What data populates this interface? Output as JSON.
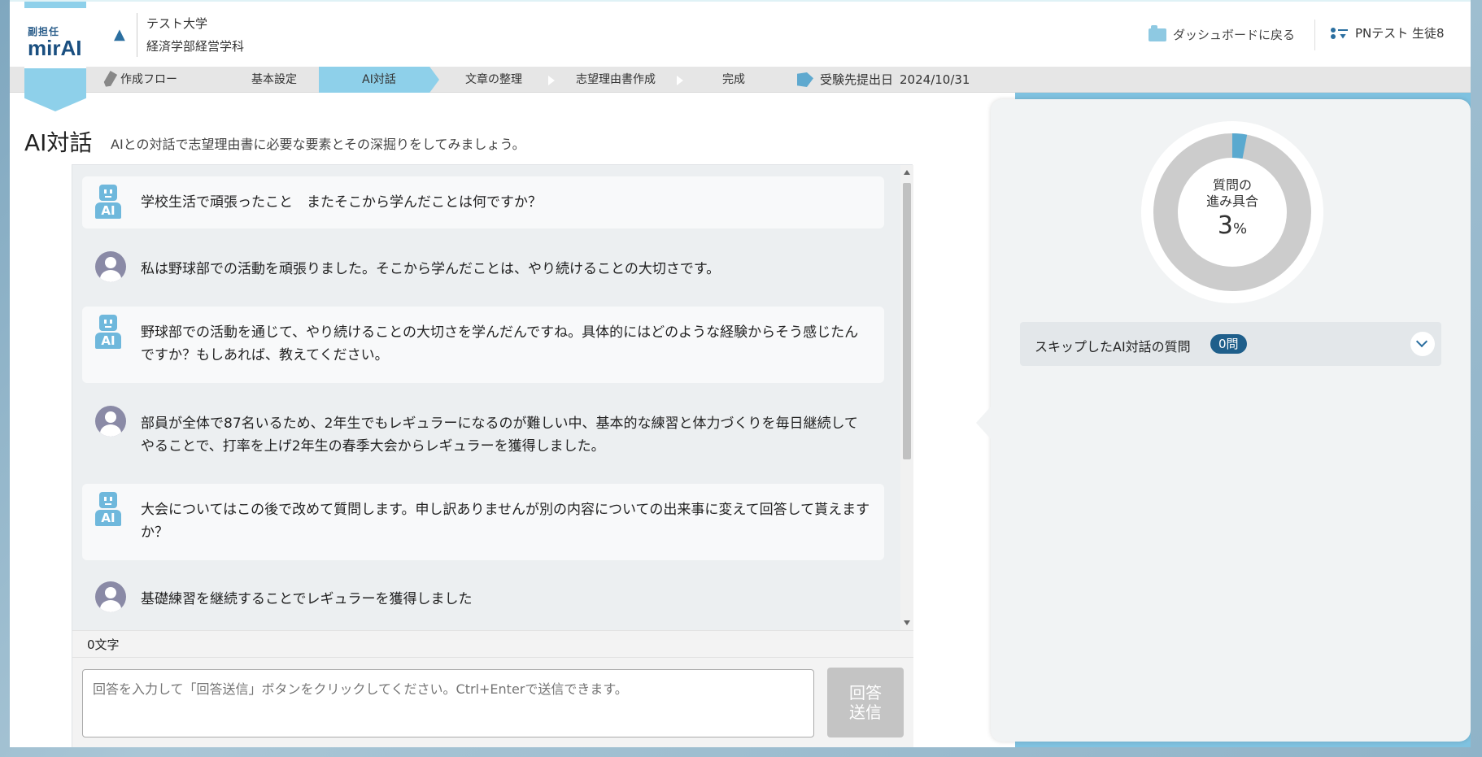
{
  "header": {
    "logo_small": "副担任",
    "logo_main": "mirAI",
    "university": "テスト大学",
    "department": "経済学部経営学科",
    "dashboard_link": "ダッシュボードに戻る",
    "user_name": "PNテスト 生徒8"
  },
  "steps": {
    "flow_label": "作成フロー",
    "items": [
      "基本設定",
      "AI対話",
      "文章の整理",
      "志望理由書作成",
      "完成"
    ],
    "active_index": 1,
    "deadline_label": "受験先提出日",
    "deadline_date": "2024/10/31"
  },
  "page": {
    "title": "AI対話",
    "description": "AIとの対話で志望理由書に必要な要素とその深掘りをしてみましょう。"
  },
  "icons": {
    "ai_badge": "AI"
  },
  "messages": [
    {
      "role": "ai",
      "text": "学校生活で頑張ったこと　またそこから学んだことは何ですか？"
    },
    {
      "role": "user",
      "text": "私は野球部での活動を頑張りました。そこから学んだことは、やり続けることの大切さです。"
    },
    {
      "role": "ai",
      "text": "野球部での活動を通じて、やり続けることの大切さを学んだんですね。具体的にはどのような経験からそう感じたんですか？もしあれば、教えてください。"
    },
    {
      "role": "user",
      "text": "部員が全体で87名いるため、2年生でもレギュラーになるのが難しい中、基本的な練習と体力づくりを毎日継続してやることで、打率を上げ2年生の春季大会からレギュラーを獲得しました。"
    },
    {
      "role": "ai",
      "text": "大会についてはこの後で改めて質問します。申し訳ありませんが別の内容についての出来事に変えて回答して貰えますか？"
    },
    {
      "role": "user",
      "text": "基礎練習を継続することでレギュラーを獲得しました"
    }
  ],
  "input": {
    "char_count": "0文字",
    "placeholder": "回答を入力して「回答送信」ボタンをクリックしてください。Ctrl+Enterで送信できます。",
    "value": "",
    "send_label_line1": "回答",
    "send_label_line2": "送信"
  },
  "progress": {
    "label_line1": "質問の",
    "label_line2": "進み具合",
    "percent": 3,
    "percent_unit": "%"
  },
  "skipped": {
    "label": "スキップしたAI対話の質問",
    "count_label": "0問"
  },
  "colors": {
    "accent": "#8ed0ea",
    "brand": "#1f5f8b",
    "progress_fill": "#5aa9cf",
    "progress_track": "#cccccc"
  }
}
